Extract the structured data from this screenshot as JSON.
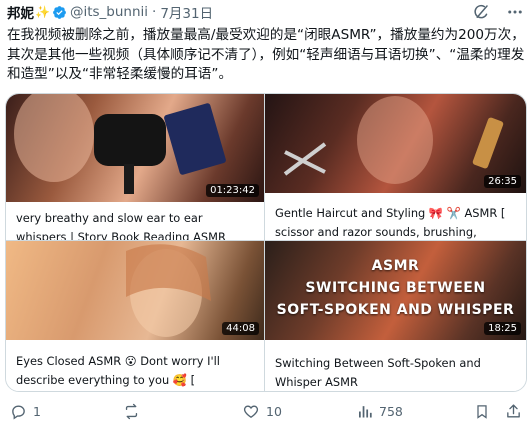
{
  "author": {
    "display_name": "邦妮",
    "sparkle": "✨",
    "handle": "@its_bunnii",
    "separator": "·",
    "date": "7月31日"
  },
  "tweet": {
    "text": "在我视频被删除之前，播放量最高/最受欢迎的是“闭眼ASMR”，播放量约为200万次，其次是其他一些视频（具体顺序记不清了），例如“轻声细语与耳语切换”、“温柔的理发和造型”以及“非常轻柔缓慢的耳语”。"
  },
  "cards": [
    {
      "duration": "01:23:42",
      "title": "very breathy and slow ear to ear whispers | Story Book Reading ASMR"
    },
    {
      "duration": "26:35",
      "title": "Gentle Haircut and Styling 🎀 ✂️ ASMR [ scissor and razor sounds, brushing,"
    },
    {
      "duration": "44:08",
      "title": "Eyes Closed ASMR 😮 Dont worry I'll describe everything to you 🥰 ["
    },
    {
      "duration": "18:25",
      "title": "Switching Between Soft-Spoken and Whisper ASMR",
      "overlay_lines": [
        "ASMR",
        "SWITCHING BETWEEN",
        "SOFT-SPOKEN AND WHISPER"
      ]
    }
  ],
  "actions": {
    "replies": "1",
    "reposts": "",
    "likes": "10",
    "views": "758"
  },
  "icons": [
    "verified-badge-icon",
    "grok-icon",
    "more-icon",
    "reply-icon",
    "repost-icon",
    "like-icon",
    "views-icon",
    "bookmark-icon",
    "share-icon"
  ],
  "colors": {
    "verified": "#1d9bf0",
    "secondary_text": "#536471",
    "border": "#cfd9de",
    "text": "#0f1419"
  }
}
